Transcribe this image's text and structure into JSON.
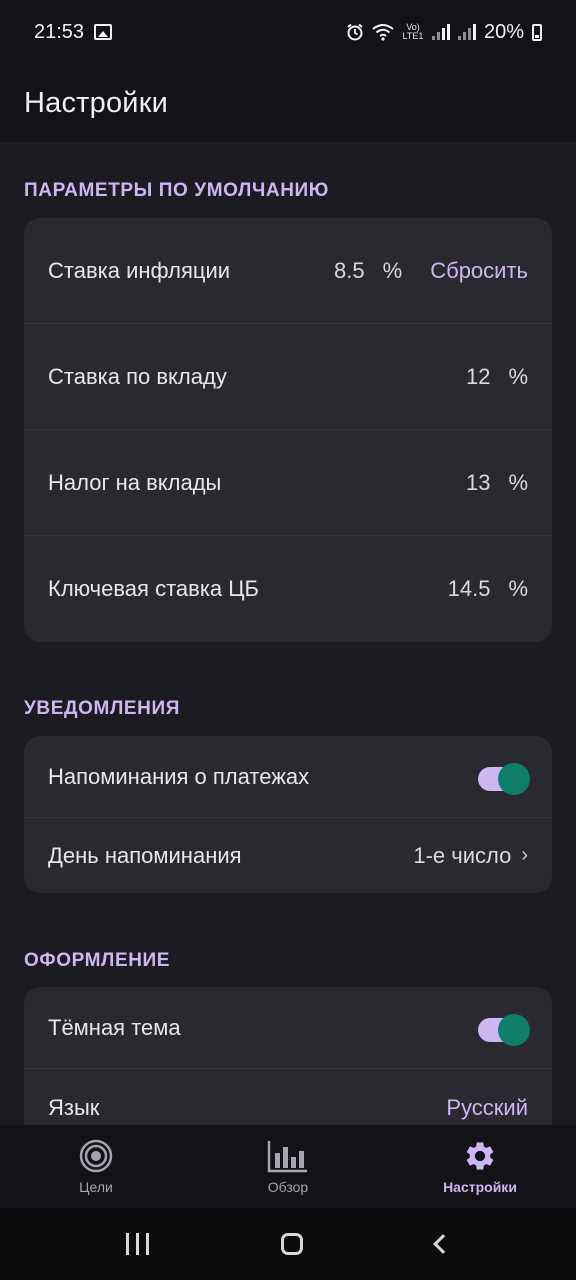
{
  "status_bar": {
    "time": "21:53",
    "network_label": "Vo) LTE1",
    "battery": "20%"
  },
  "app_bar": {
    "title": "Настройки"
  },
  "defaults": {
    "title": "ПАРАМЕТРЫ ПО УМОЛЧАНИЮ",
    "rows": [
      {
        "label": "Ставка инфляции",
        "value": "8.5",
        "unit": "%",
        "action": "Сбросить"
      },
      {
        "label": "Ставка по вкладу",
        "value": "12",
        "unit": "%"
      },
      {
        "label": "Налог на вклады",
        "value": "13",
        "unit": "%"
      },
      {
        "label": "Ключевая ставка ЦБ",
        "value": "14.5",
        "unit": "%"
      }
    ]
  },
  "notifications": {
    "title": "УВЕДОМЛЕНИЯ",
    "payment_reminders": {
      "label": "Напоминания о платежах",
      "enabled": true
    },
    "reminder_day": {
      "label": "День напоминания",
      "value": "1-е число",
      "chevron": "›"
    }
  },
  "appearance": {
    "title": "ОФОРМЛЕНИЕ",
    "dark_theme": {
      "label": "Тёмная тема",
      "enabled": true
    },
    "language": {
      "label": "Язык",
      "value": "Русский"
    }
  },
  "bottom_nav": {
    "items": [
      {
        "label": "Цели",
        "icon": "target-icon",
        "active": false
      },
      {
        "label": "Обзор",
        "icon": "bar-chart-icon",
        "active": false
      },
      {
        "label": "Настройки",
        "icon": "gear-icon",
        "active": true
      }
    ]
  },
  "colors": {
    "accent": "#cdb6f2",
    "toggle_thumb": "#0f7d6b",
    "background": "#1c1b21",
    "card": "#2a2930"
  }
}
